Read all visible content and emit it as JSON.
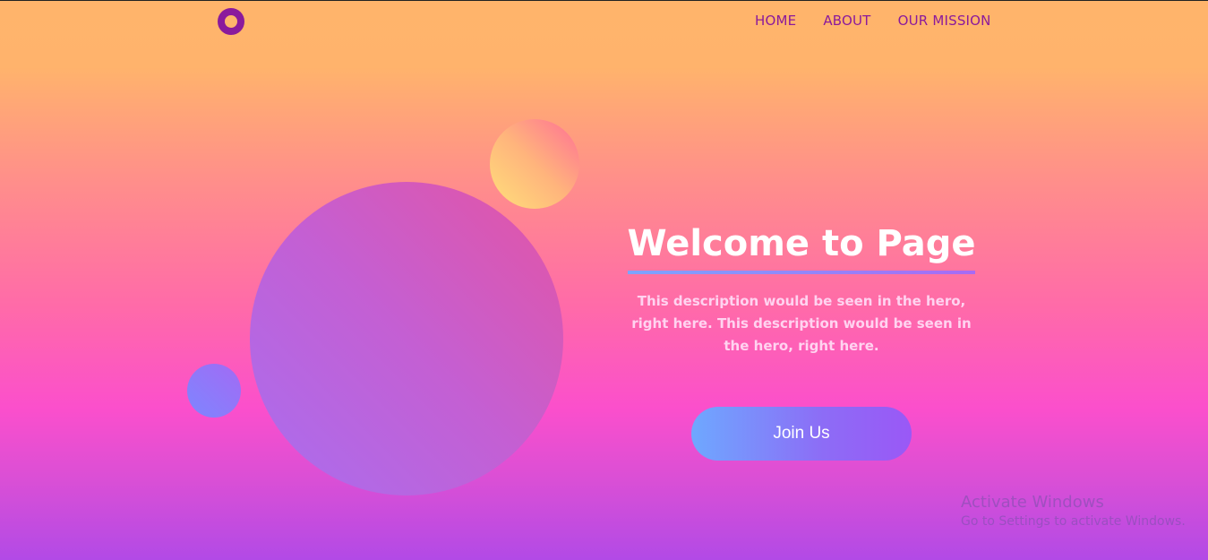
{
  "nav": {
    "items": [
      {
        "label": "HOME"
      },
      {
        "label": "ABOUT"
      },
      {
        "label": "OUR MISSION"
      }
    ]
  },
  "hero": {
    "title": "Welcome to Page",
    "description": "This description would be seen in the hero, right here. This description would be seen in the hero, right here.",
    "cta_label": "Join Us"
  },
  "watermark": {
    "line1": "Activate Windows",
    "line2": "Go to Settings to activate Windows."
  },
  "colors": {
    "brand_purple": "#8b1a9c",
    "button_start": "#6ea8ff",
    "button_end": "#9a58f6"
  }
}
